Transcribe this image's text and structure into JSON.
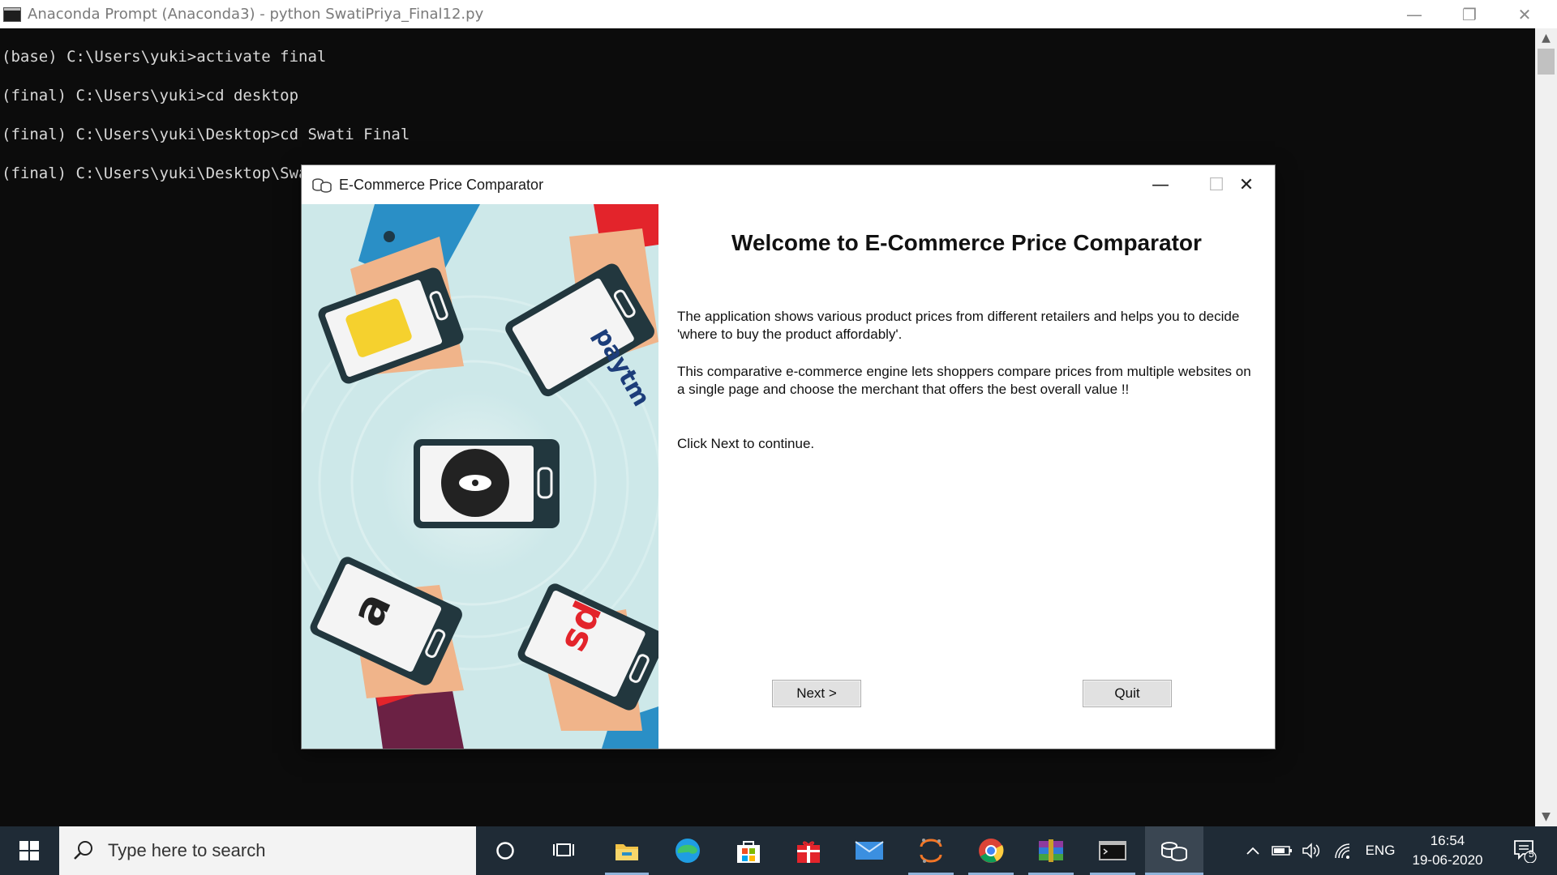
{
  "console": {
    "title": "Anaconda Prompt (Anaconda3) - python  SwatiPriya_Final12.py",
    "lines": [
      "(base) C:\\Users\\yuki>activate final",
      "(final) C:\\Users\\yuki>cd desktop",
      "(final) C:\\Users\\yuki\\Desktop>cd Swati Final",
      "(final) C:\\Users\\yuki\\Desktop\\Swat"
    ],
    "minimize_glyph": "—",
    "restore_glyph": "❐",
    "close_glyph": "✕"
  },
  "dialog": {
    "title": "E-Commerce Price Comparator",
    "heading": "Welcome to E-Commerce Price Comparator",
    "paragraph1": "The application shows various product prices from different retailers and helps you to decide 'where to buy the product affordably'.",
    "paragraph2": "This comparative e-commerce engine lets shoppers compare prices from multiple websites on a single page and choose the merchant that offers the best overall value !!",
    "paragraph3": "Click Next to continue.",
    "next_label": "Next >",
    "quit_label": "Quit",
    "minimize_glyph": "—",
    "maximize_glyph": "☐",
    "close_glyph": "✕"
  },
  "illustration": {
    "brands": [
      "paytm",
      "a",
      "sd"
    ]
  },
  "taskbar": {
    "search_placeholder": "Type here to search",
    "language": "ENG",
    "time": "16:54",
    "date": "19-06-2020",
    "notification_count": "5",
    "pinned": [
      "cortana-icon",
      "task-view-icon",
      "file-explorer-icon",
      "edge-icon",
      "store-icon",
      "gift-icon",
      "mail-icon",
      "jupyter-icon",
      "chrome-icon",
      "winrar-icon",
      "terminal-icon",
      "python-app-icon"
    ]
  },
  "colors": {
    "taskbar": "#1f2b36",
    "illustration_bg": "#cde8e9",
    "console_bg": "#0c0c0c"
  }
}
